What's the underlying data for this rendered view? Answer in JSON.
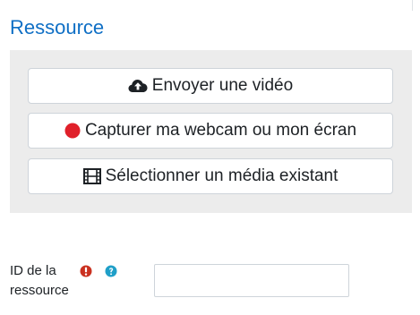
{
  "section": {
    "title": "Ressource"
  },
  "actions": {
    "upload_label": "Envoyer une vidéo",
    "upload_icon": "cloud-upload-icon",
    "record_label": "Capturer ma webcam ou mon écran",
    "record_icon": "record-dot-icon",
    "select_label": "Sélectionner un média existant",
    "select_icon": "film-icon"
  },
  "field": {
    "label": "ID de la ressource",
    "value": "",
    "required_icon": "exclamation-circle-icon",
    "help_icon": "question-circle-icon"
  },
  "colors": {
    "title": "#0f6fc5",
    "panel_bg": "#ececec",
    "required": "#ca3120",
    "help": "#1f9fc8",
    "record": "#e0202a"
  }
}
